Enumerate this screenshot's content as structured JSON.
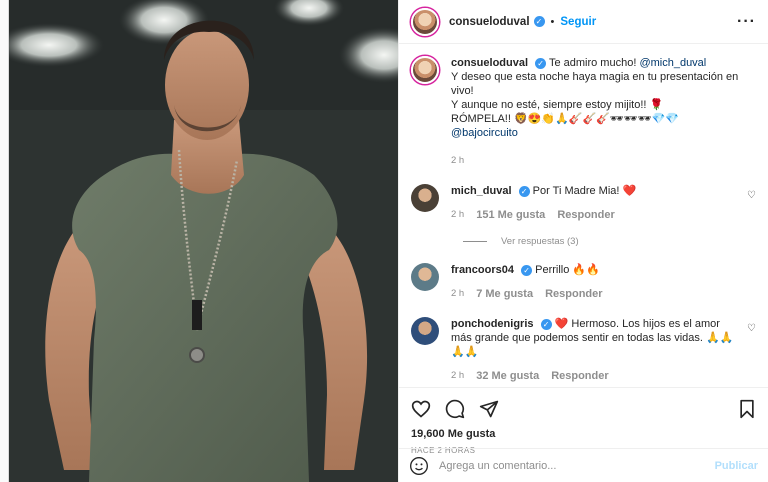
{
  "post": {
    "author": "consueloduval",
    "follow_label": "Seguir",
    "more_label": "···",
    "dot": "•"
  },
  "caption": {
    "author": "consueloduval",
    "lines": [
      "Te admiro mucho! ",
      "Y deseo que esta noche haya magia en tu presentación en vivo!",
      "Y aunque no esté, siempre estoy mijito!! 🌹",
      "RÓMPELA!! 🦁😍👏🙏🎸🎸🎸🕶🕶🕶💎💎"
    ],
    "mention1": "@mich_duval",
    "mention2": "@bajocircuito",
    "time": "2 h"
  },
  "comments": [
    {
      "user": "mich_duval",
      "text": "Por Ti Madre Mia! ❤️",
      "time": "2 h",
      "likes": "151 Me gusta",
      "reply": "Responder",
      "view_replies": "Ver respuestas (3)"
    },
    {
      "user": "francoors04",
      "text": "Perrillo 🔥🔥",
      "time": "2 h",
      "likes": "7 Me gusta",
      "reply": "Responder"
    },
    {
      "user": "ponchodenigris",
      "text": "❤️ Hermoso. Los hijos es el amor más grande que podemos sentir en todas las vidas. 🙏🙏🙏🙏",
      "time": "2 h",
      "likes": "32 Me gusta",
      "reply": "Responder"
    }
  ],
  "stats": {
    "likes": "19,600 Me gusta",
    "posted": "HACE 2 HORAS"
  },
  "composer": {
    "placeholder": "Agrega un comentario...",
    "publish": "Publicar"
  },
  "icons": [
    "heart-icon",
    "comment-icon",
    "share-icon",
    "bookmark-icon",
    "emoji-icon",
    "verified-icon"
  ],
  "colors": {
    "link": "#0095f6",
    "mention": "#00376b",
    "muted": "#8e8e8e",
    "publish_disabled": "#b2dffc",
    "verified": "#3897f0"
  }
}
